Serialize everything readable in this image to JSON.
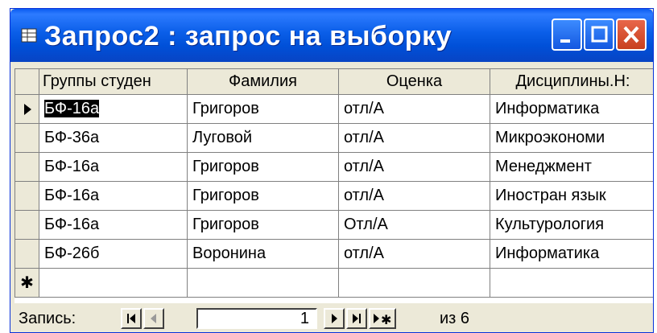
{
  "window": {
    "title": "Запрос2 : запрос на выборку"
  },
  "columns": [
    "Группы студен",
    "Фамилия",
    "Оценка",
    "Дисциплины.Н:"
  ],
  "rows": [
    [
      "БФ-16а",
      "Григоров",
      "отл/А",
      "Информатика"
    ],
    [
      "БФ-36а",
      "Луговой",
      "отл/А",
      "Микроэкономи"
    ],
    [
      "БФ-16а",
      "Григоров",
      "отл/А",
      "Менеджмент"
    ],
    [
      "БФ-16а",
      "Григоров",
      "отл/А",
      "Иностран язык"
    ],
    [
      "БФ-16а",
      "Григоров",
      "Отл/А",
      "Культурология"
    ],
    [
      "БФ-26б",
      "Воронина",
      "отл/А",
      "Информатика"
    ]
  ],
  "new_row_marker": "✱",
  "navigation": {
    "label": "Запись:",
    "current": "1",
    "of_label": "из 6"
  },
  "colors": {
    "title_bar": "#0a5ee8",
    "window_bg": "#ece9d8",
    "close_button": "#d34b2b"
  },
  "icons": [
    "query-icon",
    "minimize-icon",
    "maximize-icon",
    "close-icon",
    "first-record-icon",
    "prev-record-icon",
    "next-record-icon",
    "last-record-icon",
    "new-record-icon",
    "current-record-icon"
  ]
}
